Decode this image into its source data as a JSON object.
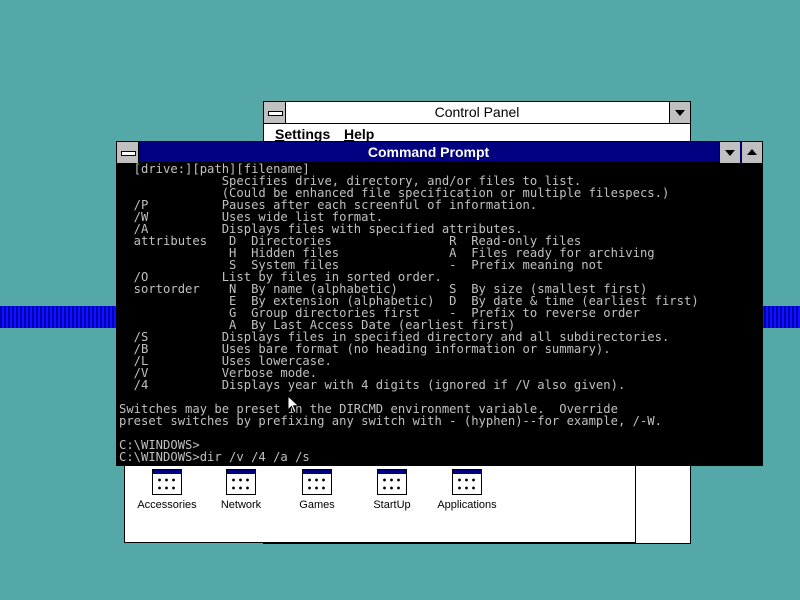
{
  "desktop": {
    "colors": {
      "background": "#54a8a8",
      "band": "#1010ff"
    }
  },
  "control_panel": {
    "title": "Control Panel",
    "menu": {
      "settings": "Settings",
      "help": "Help"
    },
    "icons": [
      {
        "label": "Accessories",
        "icon": "program-group-icon"
      },
      {
        "label": "Network",
        "icon": "program-group-icon"
      },
      {
        "label": "Games",
        "icon": "program-group-icon"
      },
      {
        "label": "StartUp",
        "icon": "program-group-icon"
      },
      {
        "label": "Applications",
        "icon": "program-group-icon"
      }
    ]
  },
  "command_prompt": {
    "title": "Command Prompt",
    "title_color": "#000080",
    "lines": [
      "  [drive:][path][filename]",
      "              Specifies drive, directory, and/or files to list.",
      "              (Could be enhanced file specification or multiple filespecs.)",
      "  /P          Pauses after each screenful of information.",
      "  /W          Uses wide list format.",
      "  /A          Displays files with specified attributes.",
      "  attributes   D  Directories                R  Read-only files",
      "               H  Hidden files               A  Files ready for archiving",
      "               S  System files               -  Prefix meaning not",
      "  /O          List by files in sorted order.",
      "  sortorder    N  By name (alphabetic)       S  By size (smallest first)",
      "               E  By extension (alphabetic)  D  By date & time (earliest first)",
      "               G  Group directories first    -  Prefix to reverse order",
      "               A  By Last Access Date (earliest first)",
      "  /S          Displays files in specified directory and all subdirectories.",
      "  /B          Uses bare format (no heading information or summary).",
      "  /L          Uses lowercase.",
      "  /V          Verbose mode.",
      "  /4          Displays year with 4 digits (ignored if /V also given).",
      "",
      "Switches may be preset in the DIRCMD environment variable.  Override",
      "preset switches by prefixing any switch with - (hyphen)--for example, /-W.",
      "",
      "C:\\WINDOWS>",
      "C:\\WINDOWS>dir /v /4 /a /s _"
    ]
  }
}
